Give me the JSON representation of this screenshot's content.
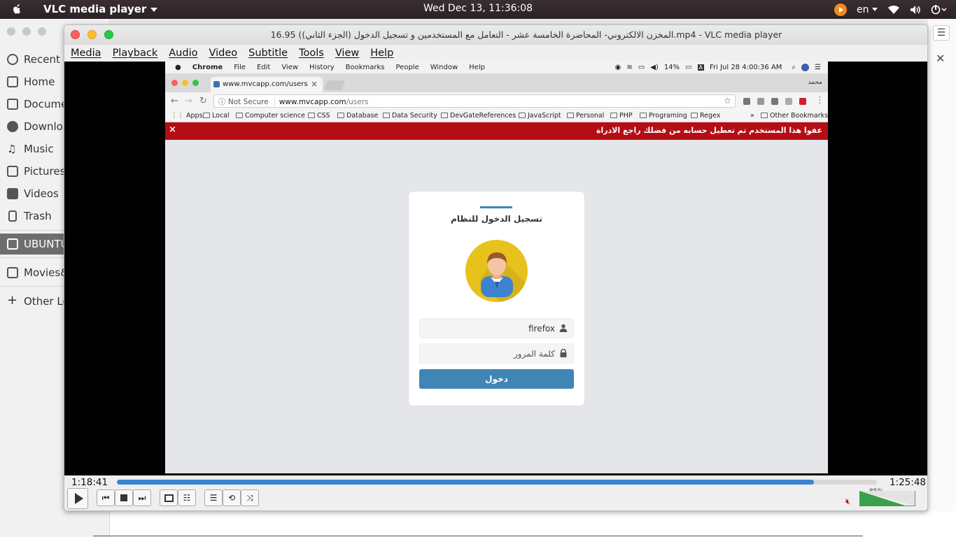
{
  "system": {
    "app_name": "VLC media player",
    "clock": "Wed Dec 13, 11:36:08",
    "language": "en",
    "icons": [
      "apple-icon",
      "vlc-tray-icon",
      "wifi-icon",
      "volume-icon",
      "power-icon"
    ]
  },
  "files_sidebar": {
    "items": [
      {
        "label": "Recent",
        "icon": "clock-icon"
      },
      {
        "label": "Home",
        "icon": "home-icon"
      },
      {
        "label": "Documents",
        "icon": "document-icon"
      },
      {
        "label": "Downloads",
        "icon": "download-icon"
      },
      {
        "label": "Music",
        "icon": "music-icon"
      },
      {
        "label": "Pictures",
        "icon": "camera-icon"
      },
      {
        "label": "Videos",
        "icon": "film-icon"
      },
      {
        "label": "Trash",
        "icon": "trash-icon"
      },
      {
        "label": "UBUNTU",
        "icon": "drive-icon"
      },
      {
        "label": "Movies&",
        "icon": "folder-icon"
      },
      {
        "label": "Other Locations",
        "icon": "plus-icon"
      }
    ]
  },
  "vlc": {
    "title": "16.95 (المخزن الالكتروني- المحاضرة الخامسة عشر - التعامل مع المستخدمين و تسجيل الدخول (الجزء الثاني).mp4 - VLC media player",
    "menu": [
      "Media",
      "Playback",
      "Audio",
      "Video",
      "Subtitle",
      "Tools",
      "View",
      "Help"
    ],
    "time_current": "1:18:41",
    "time_total": "1:25:48",
    "progress": 0.917,
    "volume_label": "85%",
    "volume": 0.85
  },
  "video_frame": {
    "mac_menu": [
      "Chrome",
      "File",
      "Edit",
      "View",
      "History",
      "Bookmarks",
      "People",
      "Window",
      "Help"
    ],
    "mac_battery": "14%",
    "mac_clock": "Fri Jul 28  4:00:36 AM",
    "chrome_user": "محمد",
    "tab_title": "www.mvcapp.com/users",
    "omnibox": {
      "security": "Not Secure",
      "host": "www.mvcapp.com",
      "path": "/users"
    },
    "bookmarks": [
      "Apps",
      "Local",
      "Computer science",
      "CSS",
      "Database",
      "Data Security",
      "DevGateReferences",
      "JavaScript",
      "Personal",
      "PHP",
      "Programing",
      "Regex"
    ],
    "bookmarks_more": "»",
    "other_bookmarks": "Other Bookmarks",
    "alert_text": "عفوا هذا المستخدم تم تعطيل حسابه من فضلك راجع الادراة",
    "alert_close": "×",
    "login": {
      "heading": "تسجيل الدخول للنظام",
      "username_value": "firefox",
      "password_placeholder": "كلمة المرور",
      "submit_label": "دخول"
    }
  },
  "colors": {
    "accent": "#3f86b5",
    "alert_bg": "#b40e14",
    "seek_fill": "#3c84d0"
  }
}
